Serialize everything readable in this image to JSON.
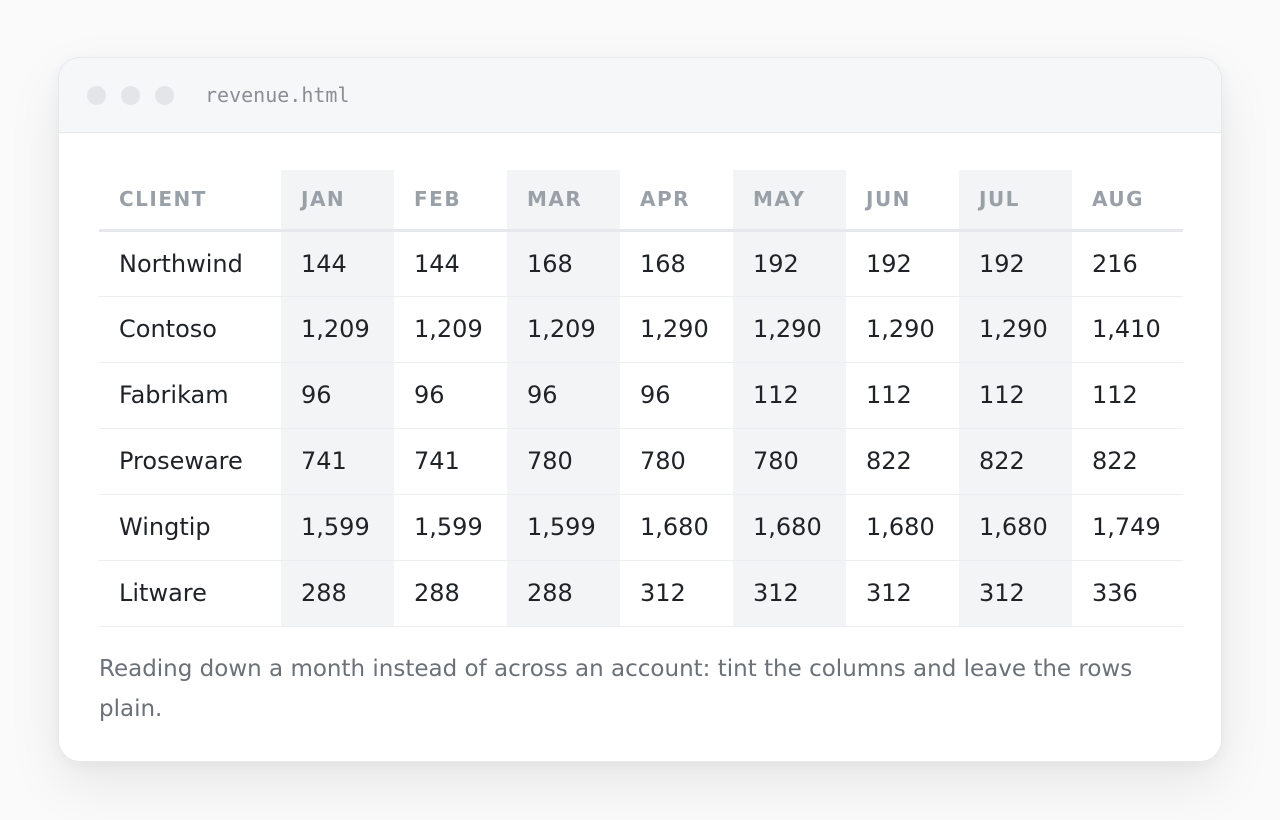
{
  "window": {
    "file_name": "revenue.html"
  },
  "table": {
    "headers": [
      "CLIENT",
      "JAN",
      "FEB",
      "MAR",
      "APR",
      "MAY",
      "JUN",
      "JUL",
      "AUG"
    ],
    "tinted_columns": [
      "JAN",
      "MAR",
      "MAY",
      "JUL"
    ],
    "rows": [
      [
        "Northwind",
        "144",
        "144",
        "168",
        "168",
        "192",
        "192",
        "192",
        "216"
      ],
      [
        "Contoso",
        "1,209",
        "1,209",
        "1,209",
        "1,290",
        "1,290",
        "1,290",
        "1,290",
        "1,410"
      ],
      [
        "Fabrikam",
        "96",
        "96",
        "96",
        "96",
        "112",
        "112",
        "112",
        "112"
      ],
      [
        "Proseware",
        "741",
        "741",
        "780",
        "780",
        "780",
        "822",
        "822",
        "822"
      ],
      [
        "Wingtip",
        "1,599",
        "1,599",
        "1,599",
        "1,680",
        "1,680",
        "1,680",
        "1,680",
        "1,749"
      ],
      [
        "Litware",
        "288",
        "288",
        "288",
        "312",
        "312",
        "312",
        "312",
        "336"
      ]
    ]
  },
  "note": "Reading down a month instead of across an account: tint the columns and leave the rows plain.",
  "colors": {
    "column_tint": "#f3f4f6",
    "header_text": "#9aa0a8",
    "body_text": "#1f2328",
    "note_text": "#6b7178"
  }
}
